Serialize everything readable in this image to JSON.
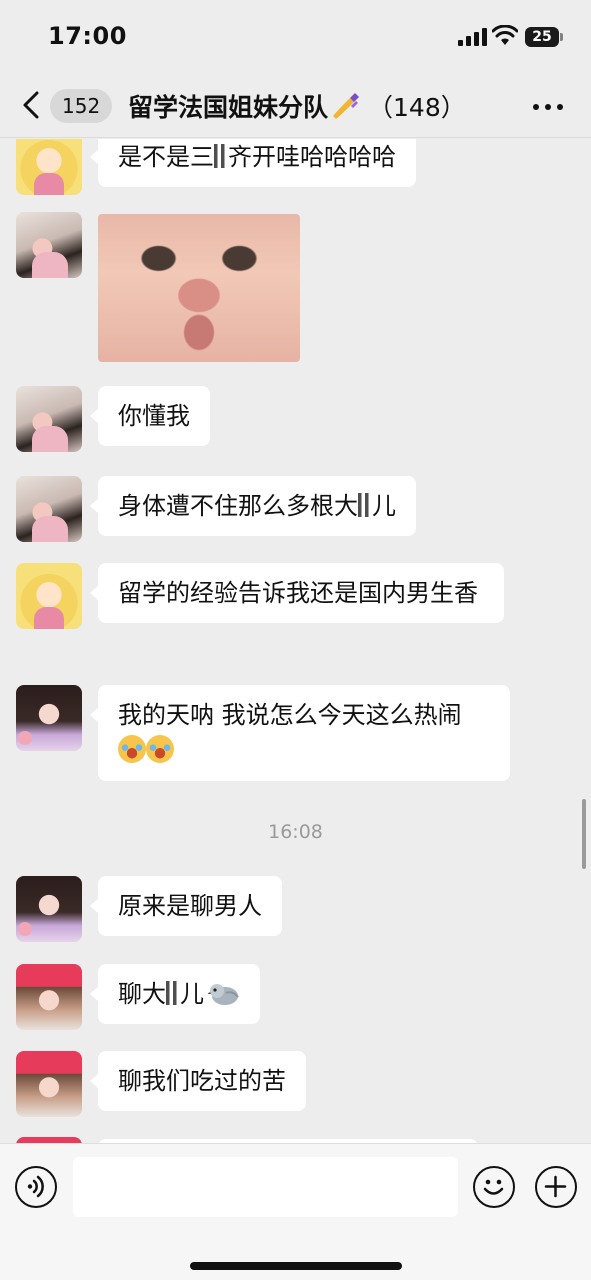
{
  "status_bar": {
    "time": "17:00",
    "battery": "25"
  },
  "nav": {
    "unread_count": "152",
    "title": "留学法国姐妹分队",
    "member_count": "（148）"
  },
  "messages": [
    {
      "avatar": "anime-blonde-girl",
      "segments": [
        "是不是三",
        "齐开哇哈哈哈哈"
      ]
    },
    {
      "avatar": "girl-with-phone",
      "type": "image",
      "image_desc": "crying-baby-face"
    },
    {
      "avatar": "girl-with-phone",
      "text": "你懂我"
    },
    {
      "avatar": "girl-with-phone",
      "segments": [
        "身体遭不住那么多根大",
        "儿"
      ]
    },
    {
      "avatar": "anime-blonde-girl",
      "text": "留学的经验告诉我还是国内男生香"
    },
    {
      "avatar": "girl-floral",
      "text": "我的天呐 我说怎么今天这么热闹",
      "emoji": "laughing-crying-emoji-x2"
    },
    {
      "avatar": "girl-floral",
      "text": "原来是聊男人"
    },
    {
      "avatar": "girl-red-beanie",
      "segments": [
        "聊大",
        "儿"
      ],
      "emoji": "pigeon-emoji"
    },
    {
      "avatar": "girl-red-beanie",
      "text": "聊我们吃过的苦"
    }
  ],
  "timestamp": "16:08",
  "input": {
    "placeholder": ""
  },
  "colors": {
    "background": "#ededed",
    "bubble": "#ffffff",
    "timestamp": "#9a9a9a"
  }
}
